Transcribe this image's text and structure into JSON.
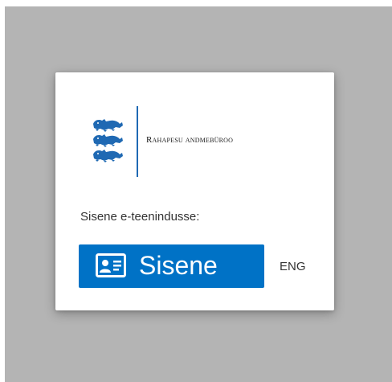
{
  "agency": {
    "name": "Rahapesu andmebüroo",
    "logo": "estonian-coat-of-arms-lions"
  },
  "login": {
    "prompt": "Sisene e-teenindusse:",
    "button_label": "Sisene",
    "button_icon": "id-card-icon"
  },
  "language": {
    "switch_label": "ENG"
  },
  "colors": {
    "accent": "#0072c6",
    "logo_blue": "#1f69b3",
    "backdrop": "#b4b4b4"
  }
}
